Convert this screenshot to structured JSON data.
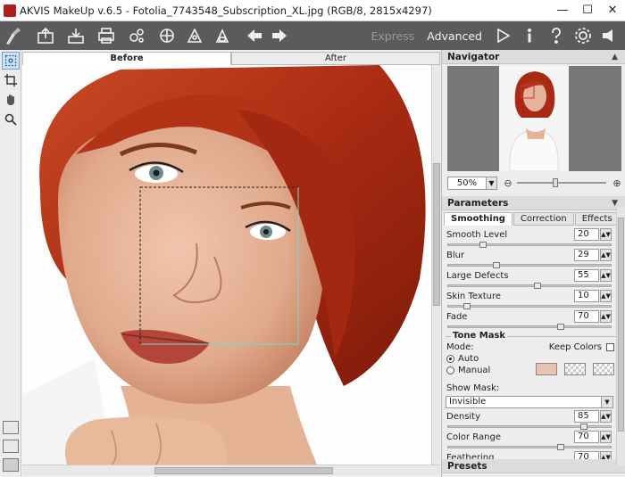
{
  "window": {
    "title": "AKVIS MakeUp v.6.5 - Fotolia_7743548_Subscription_XL.jpg (RGB/8, 2815x4297)",
    "minimize": "—",
    "maximize": "☐",
    "close": "✕"
  },
  "toolbar": {
    "icons": [
      "open-icon",
      "save-icon",
      "print-icon",
      "batch-icon",
      "presets-icon",
      "share-icon",
      "plugin-icon",
      "undo-arrow-icon",
      "redo-arrow-icon"
    ],
    "mode_express": "Express",
    "mode_advanced": "Advanced",
    "right_icons": [
      "run-icon",
      "info-icon",
      "help-icon",
      "settings-icon",
      "news-icon"
    ]
  },
  "tabs": {
    "before": "Before",
    "after": "After"
  },
  "navigator": {
    "title": "Navigator",
    "zoom": "50%"
  },
  "parameters": {
    "title": "Parameters",
    "subtabs": [
      "Smoothing",
      "Correction",
      "Effects"
    ],
    "items": [
      {
        "label": "Smooth Level",
        "value": "20",
        "pos": 0.2
      },
      {
        "label": "Blur",
        "value": "29",
        "pos": 0.29
      },
      {
        "label": "Large Defects",
        "value": "55",
        "pos": 0.55
      },
      {
        "label": "Skin Texture",
        "value": "10",
        "pos": 0.1
      },
      {
        "label": "Fade",
        "value": "70",
        "pos": 0.7
      }
    ]
  },
  "tone_mask": {
    "title": "Tone Mask",
    "mode_label": "Mode:",
    "keep_colors": "Keep Colors",
    "auto": "Auto",
    "manual": "Manual",
    "swatch_color": "#e8c4b0",
    "show_mask_label": "Show Mask:",
    "show_mask_value": "Invisible",
    "items": [
      {
        "label": "Density",
        "value": "85",
        "pos": 0.85
      },
      {
        "label": "Color Range",
        "value": "70",
        "pos": 0.7
      },
      {
        "label": "Feathering",
        "value": "70",
        "pos": 0.7
      }
    ]
  },
  "presets": {
    "title": "Presets"
  },
  "colors": {
    "toolbar": "#5b5b5b",
    "hair": "#b5301a",
    "skin": "#e3b49a"
  }
}
